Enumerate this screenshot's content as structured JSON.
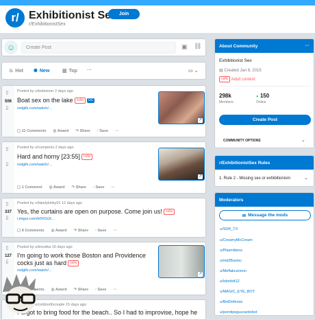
{
  "header": {
    "icon_text": "r/",
    "sub_name": "Exhibitionist Sex",
    "join_label": "Join",
    "sub_path": "r/ExhibitionistSex"
  },
  "create_post": {
    "placeholder": "Create Post"
  },
  "sort": {
    "hot": "Hot",
    "new": "New",
    "top": "Top",
    "more": "···"
  },
  "posts": [
    {
      "score": "506",
      "meta": "Posted by u/boboexer 2 days ago",
      "title": "Boat sex on the lake",
      "flair": "nsfw",
      "tag": "OC",
      "link": "redgifs.com/watch/...",
      "comments": "11 Comments",
      "award": "Award",
      "share": "Share",
      "save": "Save"
    },
    {
      "score": "",
      "meta": "Posted by u/cumpenis 2 days ago",
      "title": "Hard and horny [23:55]",
      "flair": "nsfw",
      "link": "redgifs.com/watch/...",
      "comments": "1 Comment",
      "award": "Award",
      "share": "Share",
      "save": "Save"
    },
    {
      "score": "337",
      "meta": "Posted by u/bipolykinky01 12 days ago",
      "title": "Yes, the curtains are open on purpose. Come join us!",
      "flair": "nsfw",
      "link": "i.imgur.com/b0VGGf...",
      "comments": "8 Comments",
      "award": "Award",
      "share": "Share",
      "save": "Save"
    },
    {
      "score": "127",
      "meta": "Posted by u/knoxika 15 days ago",
      "title_line1": "I'm going to work those Boston and Providence",
      "title_line2": "cocks just as hard",
      "flair": "nsfw",
      "link": "redgifs.com/watch/...",
      "comments": "9 Comments",
      "award": "Award",
      "share": "Share",
      "save": "Save"
    },
    {
      "meta": "Posted by u/coldnorthcouple 15 days ago",
      "title": "Forgot to bring food for the beach.. So I had to improvise, hope he"
    }
  ],
  "about": {
    "heading": "About Community",
    "name": "Exhibitionist Sex",
    "created": "Created Jan 6, 2015",
    "flair": "nsfw",
    "adult": "Adult content",
    "members_count": "298k",
    "members_label": "Members",
    "online_count": "150",
    "online_label": "Online",
    "create_post": "Create Post",
    "options": "COMMUNITY OPTIONS"
  },
  "rules": {
    "heading": "r/ExhibitionistSex Rules",
    "rule1": "1. Rule 2 - Missing sex or exhibitionism"
  },
  "moderators": {
    "heading": "Moderators",
    "message": "Message the mods",
    "list": [
      "u/SDR_TX",
      "u/CreamyMcCream",
      "u/Plasmittens",
      "u/md2Busmc",
      "u/Meflakcannon",
      "u/lobofett12",
      "u/MAGIC_EYE_BOT",
      "u/BotDefense",
      "u/porntipsguzzardobot"
    ]
  },
  "colors": {
    "accent": "#0079d3",
    "nsfw": "#ff585b",
    "online": "#46d160"
  }
}
